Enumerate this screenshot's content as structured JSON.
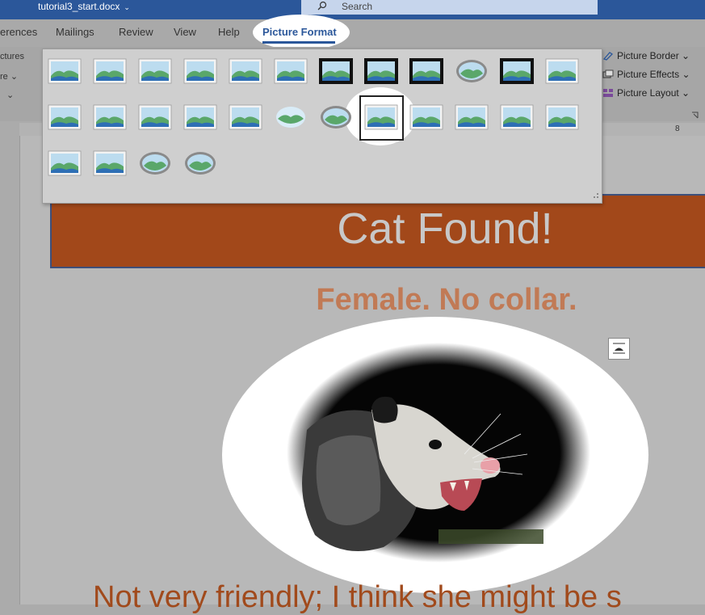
{
  "titlebar": {
    "doc_name": "tutorial3_start.docx",
    "doc_chevron": "⌄",
    "search_placeholder": "Search"
  },
  "tabs": [
    {
      "label": "erences"
    },
    {
      "label": "Mailings"
    },
    {
      "label": "Review"
    },
    {
      "label": "View"
    },
    {
      "label": "Help"
    }
  ],
  "active_tab": {
    "label": "Picture Format"
  },
  "ribbon_left": {
    "line1": "ctures",
    "line2": "re ⌄",
    "line3": "⌄"
  },
  "ribbon_right": {
    "border": "Picture Border ⌄",
    "effects": "Picture Effects ⌄",
    "layout": "Picture Layout ⌄"
  },
  "ruler": {
    "mark": "8"
  },
  "gallery": {
    "selected_index": 17,
    "styles": [
      "simple-frame-white",
      "beveled-matte-white",
      "metal-frame",
      "drop-shadow-rectangle",
      "reflected-rounded-rectangle",
      "soft-edge-rectangle",
      "double-frame-black",
      "thick-matte-black",
      "simple-frame-black",
      "metal-oval",
      "compound-frame-black",
      "center-shadow-rectangle",
      "simple-frame-white-2",
      "rounded-diagonal-corner",
      "snip-diagonal-corner",
      "moderate-frame-white",
      "rotated-white",
      "perspective-shadow",
      "soft-edge-oval",
      "bevel-rectangle",
      "bevel-perspective",
      "reflected-bevel",
      "perspective-tilted",
      "relaxed-perspective",
      "reflected-perspective-right",
      "rounded-reflected",
      "beveled-oval",
      "metal-rounded-oval"
    ]
  },
  "document": {
    "banner": "Cat Found!",
    "subtitle": "Female. No collar.",
    "bottom_text": "Not very friendly; I think she might be s"
  },
  "colors": {
    "title_bar": "#2b579a",
    "banner_fill": "#a2481a",
    "subtitle": "#c17a55",
    "body_text": "#a14a1c"
  }
}
